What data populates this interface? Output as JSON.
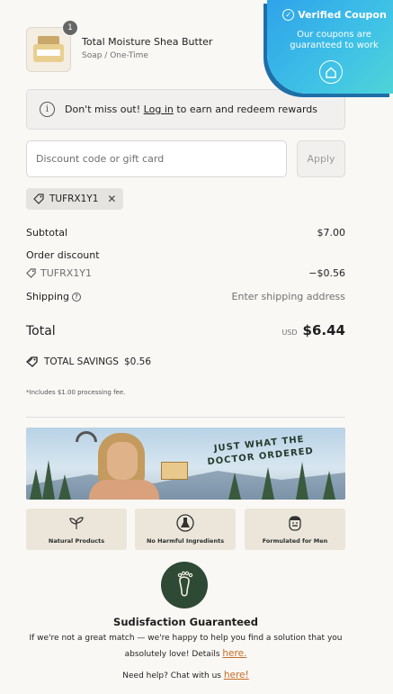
{
  "product": {
    "name": "Total Moisture Shea Butter",
    "variant": "Soap / One-Time",
    "quantity": "1"
  },
  "coupon_widget": {
    "title": "Verified Coupon",
    "subtitle": "Our coupons are guaranteed to work",
    "icon": "home-icon"
  },
  "notice": {
    "prefix": "Don't miss out!",
    "link": "Log in",
    "suffix": "to earn and redeem rewards"
  },
  "discount": {
    "placeholder": "Discount code or gift card",
    "value": "",
    "apply_label": "Apply",
    "applied_code": "TUFRX1Y1"
  },
  "summary": {
    "subtotal_label": "Subtotal",
    "subtotal_value": "$7.00",
    "order_discount_label": "Order discount",
    "discount_code": "TUFRX1Y1",
    "discount_value": "−$0.56",
    "shipping_label": "Shipping",
    "shipping_value": "Enter shipping address",
    "total_label": "Total",
    "currency": "USD",
    "total_value": "$6.44",
    "savings_label": "TOTAL SAVINGS",
    "savings_value": "$0.56",
    "fee_note": "*Includes $1.00 processing fee."
  },
  "banner": {
    "line1": "JUST WHAT THE",
    "line2": "DOCTOR ORDERED"
  },
  "features": [
    {
      "label": "Natural Products",
      "icon": "leaf-icon"
    },
    {
      "label": "No Harmful Ingredients",
      "icon": "flask-icon"
    },
    {
      "label": "Formulated for Men",
      "icon": "man-face-icon"
    }
  ],
  "guarantee": {
    "title": "Sudisfaction Guaranteed",
    "text": "If we're not a great match — we're happy to help you find a solution that you absolutely love! Details",
    "link": "here."
  },
  "help": {
    "text": "Need help? Chat with us",
    "link": "here!"
  }
}
